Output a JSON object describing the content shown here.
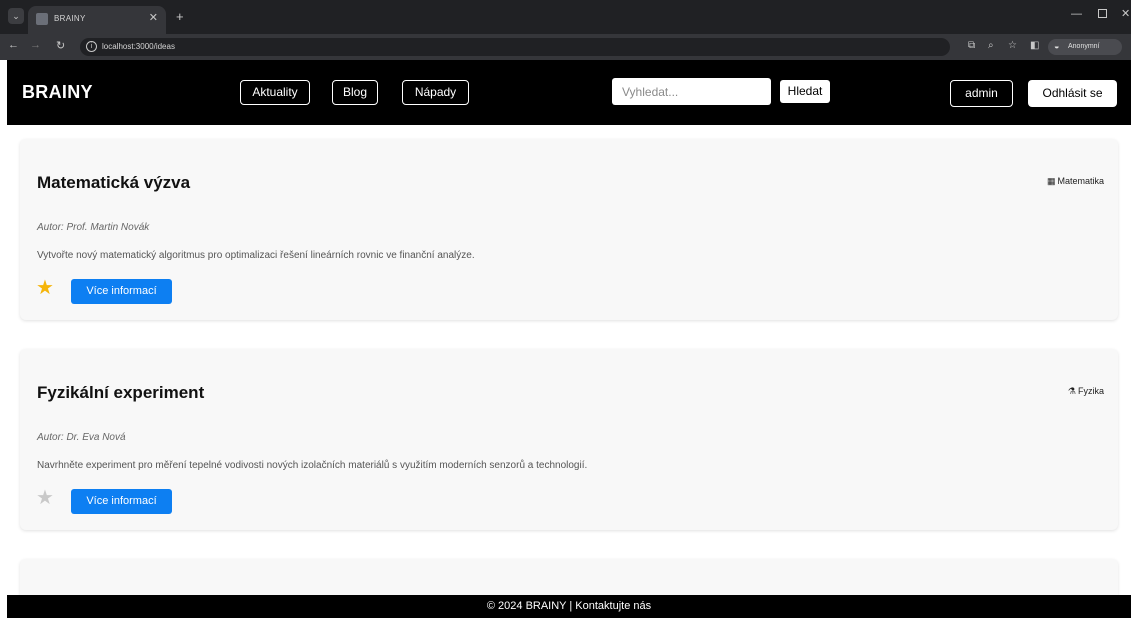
{
  "browser": {
    "tab_title": "BRAINY",
    "url": "localhost:3000/ideas",
    "profile_label": "Anonymní"
  },
  "header": {
    "brand": "BRAINY",
    "nav": [
      {
        "label": "Aktuality"
      },
      {
        "label": "Blog"
      },
      {
        "label": "Nápady"
      }
    ],
    "search": {
      "placeholder": "Vyhledat...",
      "button_label": "Hledat"
    },
    "user_label": "admin",
    "logout_label": "Odhlásit se"
  },
  "ideas": [
    {
      "title": "Matematická výzva",
      "category": "Matematika",
      "category_icon": "calculator-icon",
      "author": "Autor: Prof. Martin Novák",
      "description": "Vytvořte nový matematický algoritmus pro optimalizaci řešení lineárních rovnic ve finanční analýze.",
      "favorite": true,
      "button_label": "Více informací"
    },
    {
      "title": "Fyzikální experiment",
      "category": "Fyzika",
      "category_icon": "flask-icon",
      "author": "Autor: Dr. Eva Nová",
      "description": "Navrhněte experiment pro měření tepelné vodivosti nových izolačních materiálů s využitím moderních senzorů a technologií.",
      "favorite": false,
      "button_label": "Více informací"
    }
  ],
  "footer": {
    "text": "© 2024 BRAINY | Kontaktujte nás"
  },
  "colors": {
    "header_bg": "#000000",
    "accent": "#0d7ff2",
    "star_active": "#f5b50a",
    "star_inactive": "#c9c9c9",
    "card_bg": "#f8f8f8"
  }
}
